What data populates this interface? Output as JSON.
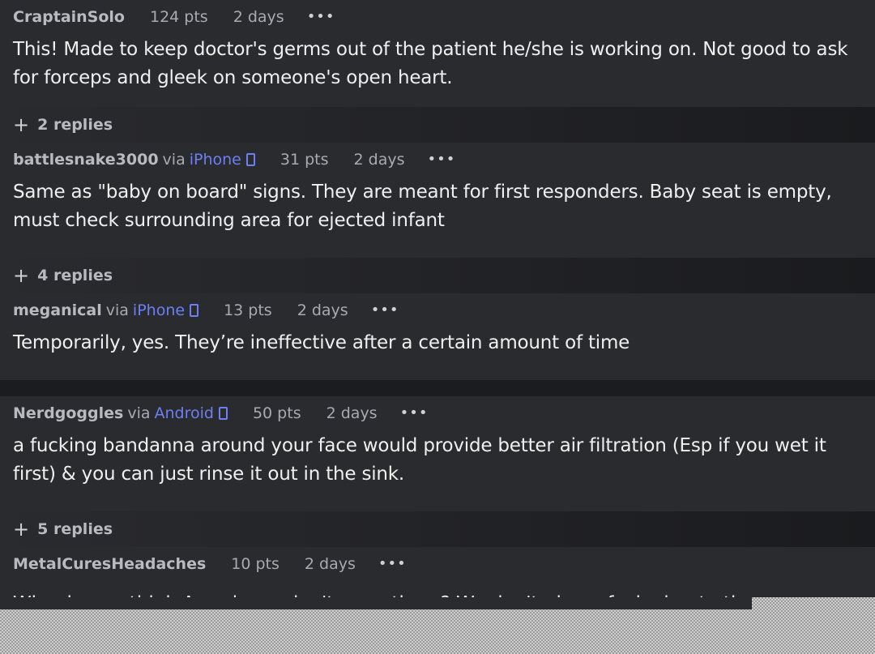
{
  "comments": [
    {
      "user": "CraptainSolo",
      "via": "",
      "device": "",
      "points": "124 pts",
      "time": "2 days",
      "body": "This! Made to keep doctor's germs out of the patient he/she is working on. Not good to ask for forceps and gleek on someone's open heart.",
      "replies": "2 replies"
    },
    {
      "user": "battlesnake3000",
      "via": "via",
      "device": "iPhone",
      "points": "31 pts",
      "time": "2 days",
      "body": "Same as \"baby on board\" signs. They are meant for first responders. Baby seat is empty, must check surrounding area for ejected infant",
      "replies": "4 replies"
    },
    {
      "user": "meganical",
      "via": "via",
      "device": "iPhone",
      "points": "13 pts",
      "time": "2 days",
      "body": "Temporarily, yes. They’re ineffective after a certain amount of time",
      "replies": ""
    },
    {
      "user": "Nerdgoggles",
      "via": "via",
      "device": "Android",
      "points": "50 pts",
      "time": "2 days",
      "body": "a fucking bandanna around your face would provide better air filtration (Esp if you wet it first) & you can just rinse it out in the sink.",
      "replies": "5 replies"
    },
    {
      "user": "MetalCuresHeadaches",
      "via": "",
      "device": "",
      "points": "10 pts",
      "time": "2 days",
      "body": "Why do you think Americans don't wear them? We don't give a fuck about other p",
      "replies": ""
    }
  ],
  "more_glyph": "•••",
  "plus_glyph": "+",
  "colors": {
    "background": "#1b1c1f",
    "comment_bg": "#2a2b2f",
    "device_link": "#6d7ff2"
  }
}
